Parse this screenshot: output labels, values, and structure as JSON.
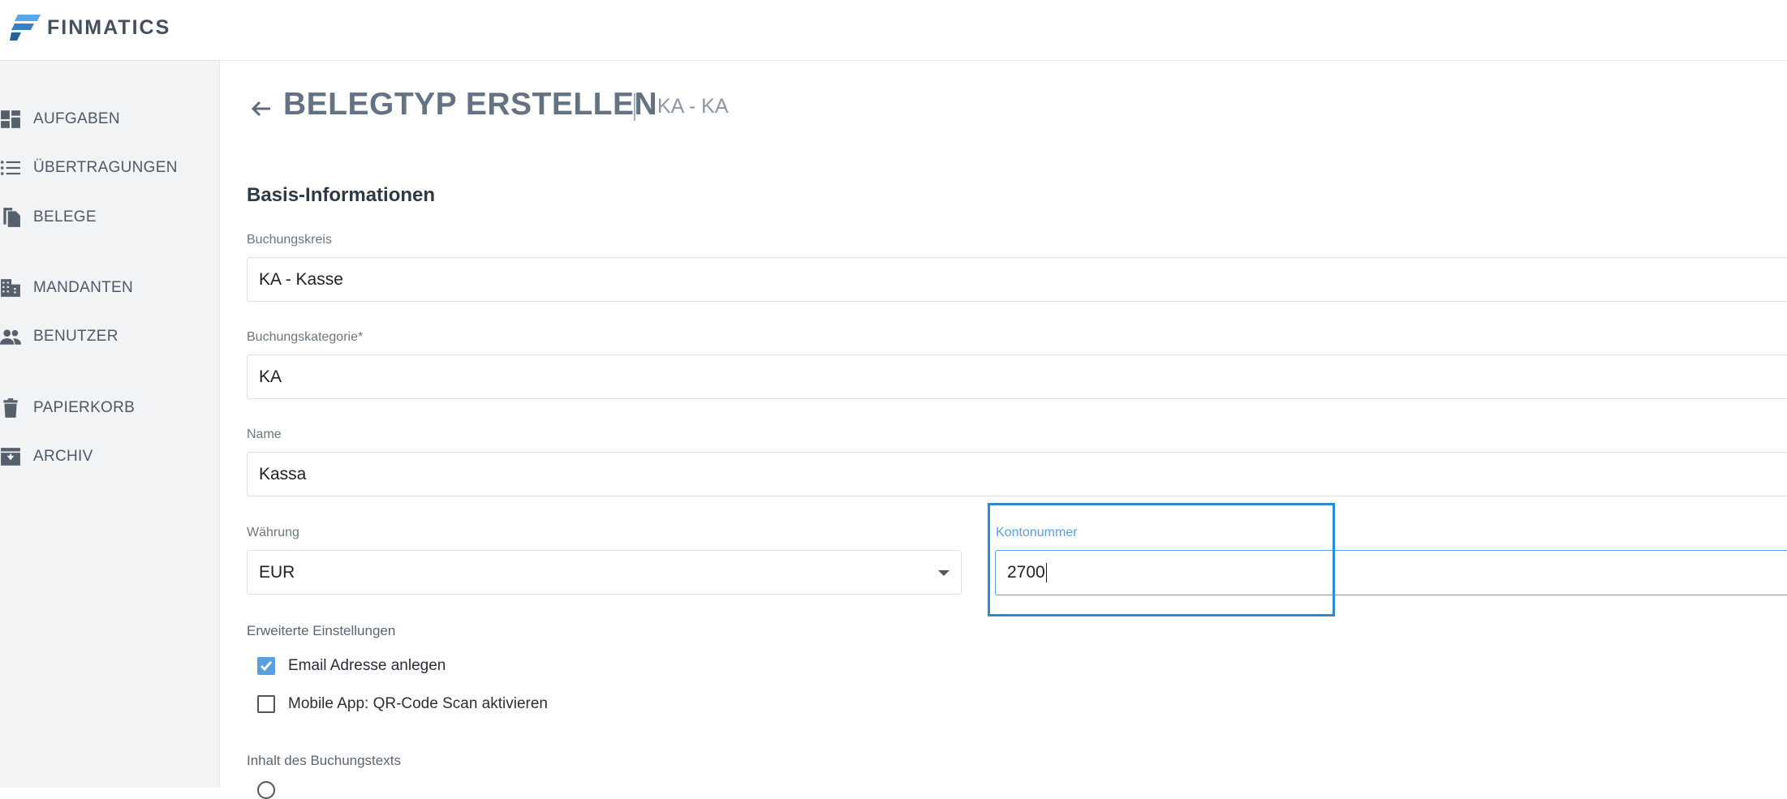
{
  "app": {
    "brand": "FINMATICS"
  },
  "sidebar": {
    "items": [
      {
        "label": "AUFGABEN",
        "icon": "dashboard-icon"
      },
      {
        "label": "ÜBERTRAGUNGEN",
        "icon": "list-icon"
      },
      {
        "label": "BELEGE",
        "icon": "documents-icon"
      },
      {
        "label": "MANDANTEN",
        "icon": "building-icon"
      },
      {
        "label": "BENUTZER",
        "icon": "people-icon"
      },
      {
        "label": "PAPIERKORB",
        "icon": "trash-icon"
      },
      {
        "label": "ARCHIV",
        "icon": "archive-icon"
      }
    ]
  },
  "header": {
    "title": "BELEGTYP ERSTELLEN",
    "subtitle": "KA - KA"
  },
  "form": {
    "section_title": "Basis-Informationen",
    "buchungskreis": {
      "label": "Buchungskreis",
      "value": "KA - Kasse"
    },
    "buchungskategorie": {
      "label": "Buchungskategorie*",
      "value": "KA"
    },
    "name": {
      "label": "Name",
      "value": "Kassa"
    },
    "waehrung": {
      "label": "Währung",
      "value": "EUR"
    },
    "kontonummer": {
      "label": "Kontonummer",
      "value": "2700"
    },
    "erweiterte": {
      "label": "Erweiterte Einstellungen",
      "options": [
        {
          "label": "Email Adresse anlegen",
          "checked": true
        },
        {
          "label": "Mobile App: QR-Code Scan aktivieren",
          "checked": false
        }
      ]
    },
    "inhalt_label": "Inhalt des Buchungstexts"
  },
  "colors": {
    "accent": "#5b9ee0",
    "highlight": "#2f8ad6",
    "sidebar_bg": "#f2f3f5",
    "logo": "#3a7fc4"
  }
}
